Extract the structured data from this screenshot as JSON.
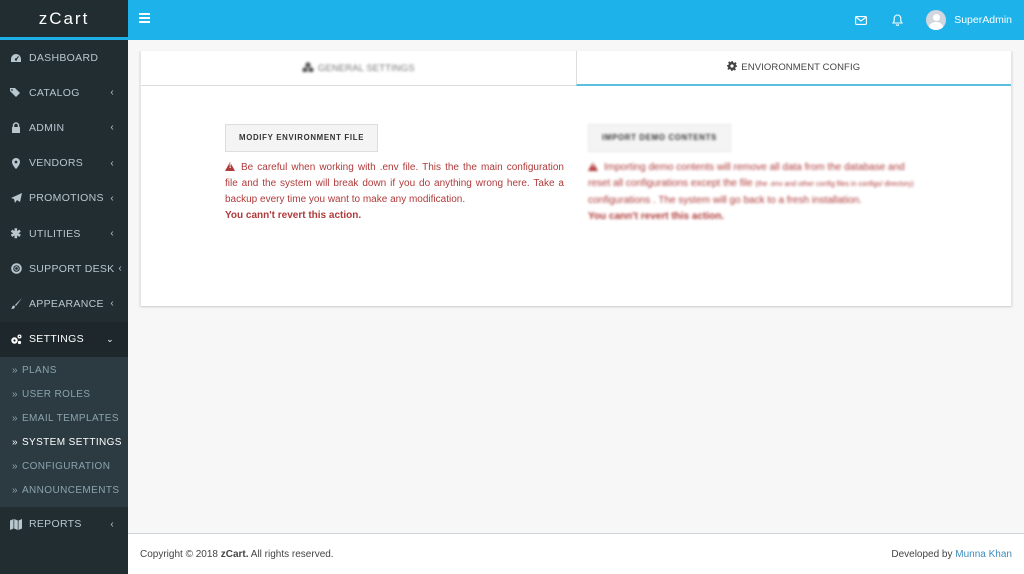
{
  "app": {
    "logo": "zCart"
  },
  "header": {
    "username": "SuperAdmin",
    "icons": [
      "menu-icon",
      "envelope-icon",
      "bell-icon",
      "avatar"
    ]
  },
  "sidebar": {
    "items": [
      {
        "label": "DASHBOARD",
        "icon": "dashboard-icon",
        "has_children": false
      },
      {
        "label": "CATALOG",
        "icon": "tags-icon",
        "has_children": true
      },
      {
        "label": "ADMIN",
        "icon": "lock-icon",
        "has_children": true
      },
      {
        "label": "VENDORS",
        "icon": "map-marker-icon",
        "has_children": true
      },
      {
        "label": "PROMOTIONS",
        "icon": "paper-plane-icon",
        "has_children": true
      },
      {
        "label": "UTILITIES",
        "icon": "asterisk-icon",
        "has_children": true
      },
      {
        "label": "SUPPORT DESK",
        "icon": "life-ring-icon",
        "has_children": true
      },
      {
        "label": "APPEARANCE",
        "icon": "paint-brush-icon",
        "has_children": true
      },
      {
        "label": "SETTINGS",
        "icon": "gears-icon",
        "has_children": true,
        "expanded": true
      },
      {
        "label": "REPORTS",
        "icon": "map-icon",
        "has_children": true
      }
    ],
    "settings_sub": [
      {
        "label": "PLANS"
      },
      {
        "label": "USER ROLES"
      },
      {
        "label": "EMAIL TEMPLATES"
      },
      {
        "label": "SYSTEM SETTINGS",
        "active": true
      },
      {
        "label": "CONFIGURATION"
      },
      {
        "label": "ANNOUNCEMENTS"
      }
    ]
  },
  "main": {
    "tabs": [
      {
        "label": "GENERAL SETTINGS",
        "icon": "cubes-icon",
        "active": false
      },
      {
        "label": "ENVIORONMENT CONFIG",
        "icon": "gear-icon",
        "active": true
      }
    ],
    "left": {
      "button": "MODIFY ENVIRONMENT FILE",
      "warning": "Be careful when working with .env file. This the the main configuration file and the system will break down if you do anything wrong here. Take a backup every time you want to make any modification.",
      "strong": "You cann't revert this action."
    },
    "right": {
      "button": "IMPORT DEMO CONTENTS",
      "warning_a": "Importing demo contents will remove all data from the database and reset all configurations except the file",
      "warning_small": "(the .env and other config files in configs/ directory)",
      "warning_b": "configurations . The system will go back to a fresh installation.",
      "strong": "You cann't revert this action."
    }
  },
  "footer": {
    "copyright_prefix": "Copyright © 2018",
    "brand": "zCart.",
    "copyright_suffix": "All rights reserved.",
    "dev_prefix": "Developed by",
    "dev_name": "Munna Khan"
  },
  "colors": {
    "accent": "#1eb2ea",
    "sidebar": "#222d32",
    "warning": "#b03a3a",
    "link": "#3c8dbc"
  }
}
